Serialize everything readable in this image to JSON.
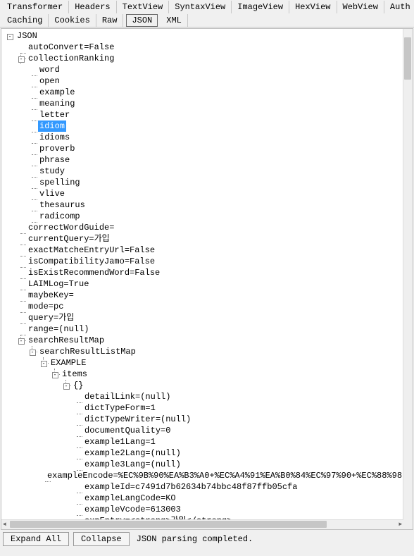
{
  "tabs_row1": [
    "Transformer",
    "Headers",
    "TextView",
    "SyntaxView",
    "ImageView",
    "HexView",
    "WebView",
    "Auth"
  ],
  "tabs_row2": [
    "Caching",
    "Cookies",
    "Raw",
    "JSON",
    "XML"
  ],
  "active_tab": "JSON",
  "buttons": {
    "expand": "Expand All",
    "collapse": "Collapse"
  },
  "status": "JSON parsing completed.",
  "selected_node": "idiom",
  "tree": {
    "root": "JSON",
    "children": [
      {
        "label": "autoConvert=False",
        "leaf": true
      },
      {
        "label": "collectionRanking",
        "expanded": true,
        "children": [
          {
            "label": "word"
          },
          {
            "label": "open"
          },
          {
            "label": "example"
          },
          {
            "label": "meaning"
          },
          {
            "label": "letter"
          },
          {
            "label": "idiom",
            "selected": true
          },
          {
            "label": "idioms"
          },
          {
            "label": "proverb"
          },
          {
            "label": "phrase"
          },
          {
            "label": "study"
          },
          {
            "label": "spelling"
          },
          {
            "label": "vlive"
          },
          {
            "label": "thesaurus"
          },
          {
            "label": "radicomp"
          }
        ]
      },
      {
        "label": "correctWordGuide=",
        "leaf": true
      },
      {
        "label": "currentQuery=가입",
        "leaf": true
      },
      {
        "label": "exactMatcheEntryUrl=False",
        "leaf": true
      },
      {
        "label": "isCompatibilityJamo=False",
        "leaf": true
      },
      {
        "label": "isExistRecommendWord=False",
        "leaf": true
      },
      {
        "label": "LAIMLog=True",
        "leaf": true
      },
      {
        "label": "maybeKey=",
        "leaf": true
      },
      {
        "label": "mode=pc",
        "leaf": true
      },
      {
        "label": "query=가입",
        "leaf": true
      },
      {
        "label": "range=(null)",
        "leaf": true
      },
      {
        "label": "searchResultMap",
        "expanded": true,
        "children": [
          {
            "label": "searchResultListMap",
            "expanded": true,
            "children": [
              {
                "label": "EXAMPLE",
                "expanded": true,
                "children": [
                  {
                    "label": "items",
                    "expanded": true,
                    "children": [
                      {
                        "label": "{}",
                        "expanded": true,
                        "children": [
                          {
                            "label": "detailLink=(null)"
                          },
                          {
                            "label": "dictTypeForm=1"
                          },
                          {
                            "label": "dictTypeWriter=(null)"
                          },
                          {
                            "label": "documentQuality=0"
                          },
                          {
                            "label": "example1Lang=1"
                          },
                          {
                            "label": "example2Lang=(null)"
                          },
                          {
                            "label": "example3Lang=(null)"
                          },
                          {
                            "label": "exampleEncode=%EC%9B%90%EA%B3%A0+%EC%A4%91%EA%B0%84%EC%97%90+%EC%88%98"
                          },
                          {
                            "label": "exampleId=c7491d7b62634b74bbc48f87ffb05cfa"
                          },
                          {
                            "label": "exampleLangCode=KO"
                          },
                          {
                            "label": "exampleVcode=613003"
                          },
                          {
                            "label": "expEntry=<strong>가입</strong>"
                          }
                        ]
                      }
                    ]
                  }
                ]
              }
            ]
          }
        ]
      }
    ]
  }
}
